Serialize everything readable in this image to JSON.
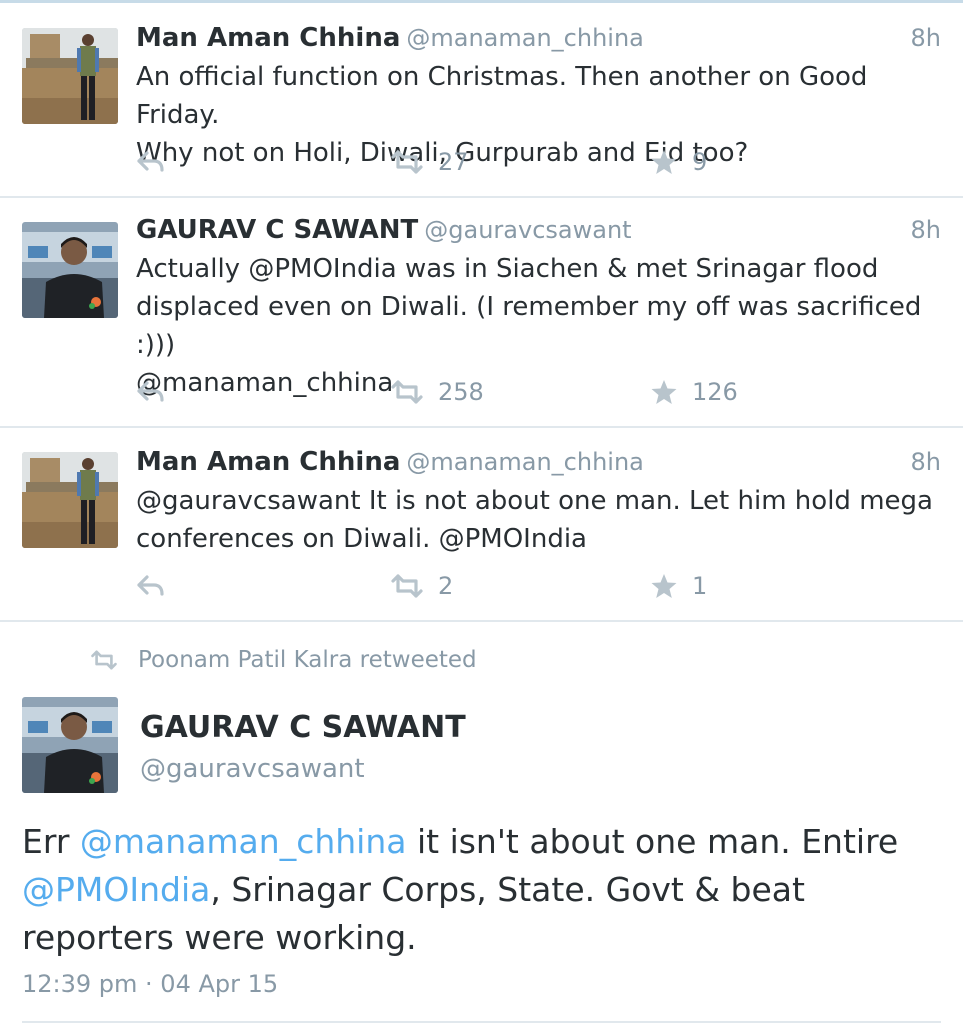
{
  "tweets": [
    {
      "name": "Man Aman Chhina",
      "handle": "@manaman_chhina",
      "time": "8h",
      "text": "An official function on Christmas. Then another on Good Friday.\nWhy not on Holi, Diwali, Gurpurab and Eid too?",
      "retweets": "27",
      "favorites": "9",
      "avatar": "photo-man-standing-near-wall"
    },
    {
      "name": "GAURAV C SAWANT",
      "handle": "@gauravcsawant",
      "time": "8h",
      "text": "Actually @PMOIndia was in Siachen & met Srinagar flood\ndisplaced even on Diwali. (I remember my off was sacrificed :)))\n@manaman_chhina",
      "retweets": "258",
      "favorites": "126",
      "avatar": "photo-man-in-newsroom"
    },
    {
      "name": "Man Aman Chhina",
      "handle": "@manaman_chhina",
      "time": "8h",
      "text": "@gauravcsawant It is not about one man. Let him hold mega\nconferences on Diwali. @PMOIndia",
      "retweets": "2",
      "favorites": "1",
      "avatar": "photo-man-standing-near-wall"
    }
  ],
  "focused": {
    "retweeted_by": "Poonam Patil Kalra retweeted",
    "name": "GAURAV C SAWANT",
    "handle": "@gauravcsawant",
    "text_parts": [
      "Err ",
      "@manaman_chhina",
      " it isn't about one man. Entire ",
      "@PMOIndia",
      ", Srinagar Corps, State. Govt & beat reporters were working."
    ],
    "timestamp": "12:39 pm · 04 Apr 15",
    "avatar": "photo-man-in-newsroom"
  },
  "colors": {
    "text": "#292f33",
    "secondary": "#8899a6",
    "link": "#55acee",
    "divider": "#e1e8ed",
    "icon": "#b8c4cc"
  },
  "icons": [
    "reply-icon",
    "retweet-icon",
    "favorite-star-icon"
  ]
}
